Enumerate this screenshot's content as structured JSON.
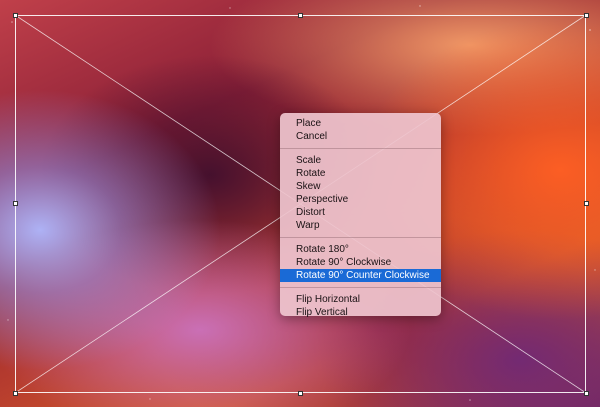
{
  "canvas": {
    "description_icon": "transform-bounding-box",
    "handle_color": "#ffffff",
    "box_line_color": "#ffffff"
  },
  "context_menu": {
    "groups": [
      {
        "items": [
          {
            "label": "Place"
          },
          {
            "label": "Cancel"
          }
        ]
      },
      {
        "items": [
          {
            "label": "Scale"
          },
          {
            "label": "Rotate"
          },
          {
            "label": "Skew"
          },
          {
            "label": "Perspective"
          },
          {
            "label": "Distort"
          },
          {
            "label": "Warp"
          }
        ]
      },
      {
        "items": [
          {
            "label": "Rotate 180°"
          },
          {
            "label": "Rotate 90° Clockwise"
          },
          {
            "label": "Rotate 90° Counter Clockwise",
            "selected": true
          }
        ]
      },
      {
        "items": [
          {
            "label": "Flip Horizontal"
          },
          {
            "label": "Flip Vertical"
          }
        ]
      }
    ],
    "highlight_color": "#1a6ad6",
    "background_color": "#eec4ce"
  }
}
